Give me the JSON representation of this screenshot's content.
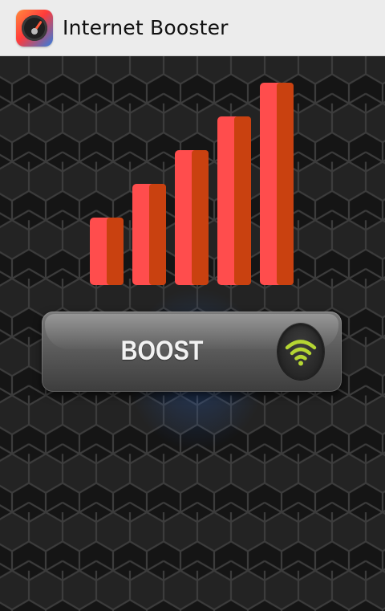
{
  "app_bar": {
    "title": "Internet Booster",
    "icon": "speedometer-icon"
  },
  "main": {
    "signal_icon": "signal-strength-bars-icon",
    "signal_bar_count": 5,
    "boost_button": {
      "label": "BOOST",
      "icon": "wifi-icon"
    }
  },
  "colors": {
    "bar_light": "#ff4d4d",
    "bar_dark": "#c94110",
    "wifi_green": "#b5d633",
    "background": "#141414",
    "hex_line": "#3a3a3a",
    "app_bar": "#ececec"
  }
}
